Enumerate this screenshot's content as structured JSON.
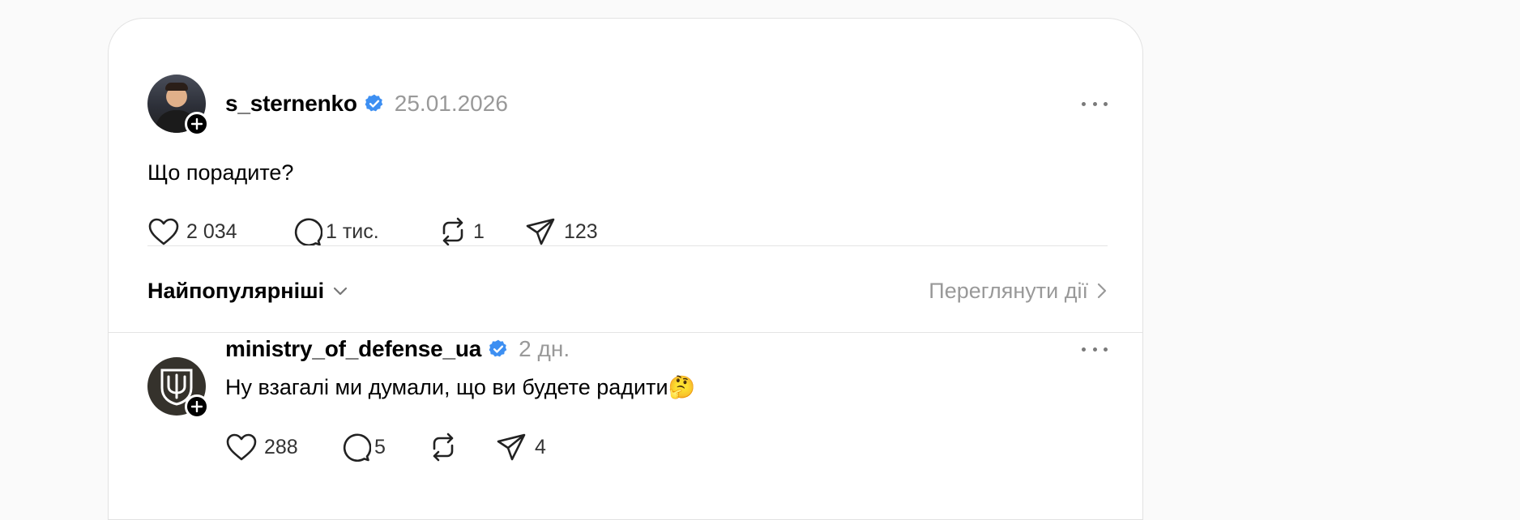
{
  "post": {
    "username": "s_sternenko",
    "date": "25.01.2026",
    "text": "Що порадите?",
    "likes": "2 034",
    "replies": "1 тис.",
    "reposts": "1",
    "shares": "123"
  },
  "sort": {
    "label": "Найпопулярніші",
    "view_activity": "Переглянути дії"
  },
  "reply": {
    "username": "ministry_of_defense_ua",
    "time": "2 дн.",
    "text": "Ну взагалі ми думали, що ви будете радити🤔",
    "likes": "288",
    "replies": "5",
    "reposts": "",
    "shares": "4"
  },
  "colors": {
    "verified": "#3d8ff2",
    "muted": "#999999",
    "accent": "#000000"
  }
}
